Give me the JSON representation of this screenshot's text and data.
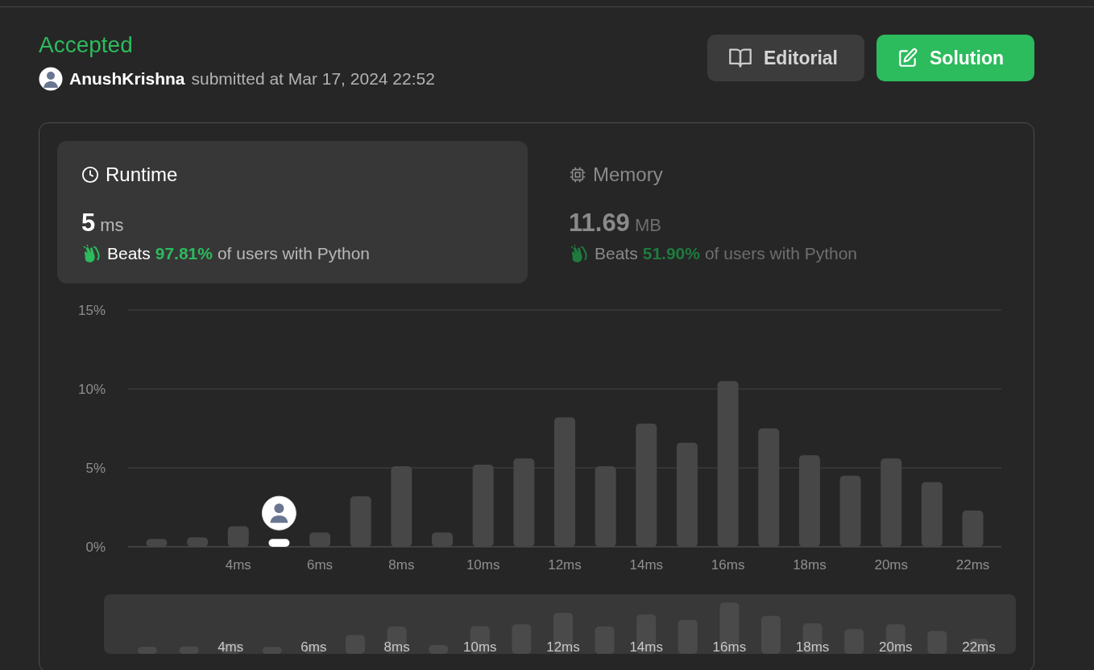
{
  "status": "Accepted",
  "submission": {
    "user": "AnushKrishna",
    "text": "submitted at Mar 17, 2024 22:52"
  },
  "buttons": [
    {
      "label": "Editorial",
      "kind": "secondary"
    },
    {
      "label": "Solution",
      "kind": "primary"
    }
  ],
  "tabs": [
    {
      "kind": "runtime",
      "label": "Runtime",
      "selected": true,
      "value": "5",
      "unit": "ms",
      "beats": "Beats",
      "percent": "97.81%",
      "suffix": "of users with Python"
    },
    {
      "kind": "memory",
      "label": "Memory",
      "selected": false,
      "value": "11.69",
      "unit": "MB",
      "beats": "Beats",
      "percent": "51.90%",
      "suffix": "of users with Python"
    }
  ],
  "chart": {
    "chart_data": {
      "type": "bar",
      "x": [
        2,
        3,
        4,
        5,
        6,
        7,
        8,
        9,
        10,
        11,
        12,
        13,
        14,
        15,
        16,
        17,
        18,
        19,
        20,
        21,
        22
      ],
      "values": [
        0.5,
        0.6,
        1.3,
        0.5,
        0.9,
        3.2,
        5.1,
        0.9,
        5.2,
        5.6,
        8.2,
        5.1,
        7.8,
        6.6,
        10.5,
        7.5,
        5.8,
        4.5,
        5.6,
        4.1,
        2.3
      ],
      "xlim": [
        1.3,
        22.7
      ],
      "ylim": [
        0,
        15
      ],
      "yticks": [
        {
          "value": 0,
          "label": "0%"
        },
        {
          "value": 5,
          "label": "5%"
        },
        {
          "value": 10,
          "label": "10%"
        },
        {
          "value": 15,
          "label": "15%"
        }
      ],
      "xticks": [
        {
          "value": 4,
          "label": "4ms"
        },
        {
          "value": 6,
          "label": "6ms"
        },
        {
          "value": 8,
          "label": "8ms"
        },
        {
          "value": 10,
          "label": "10ms"
        },
        {
          "value": 12,
          "label": "12ms"
        },
        {
          "value": 14,
          "label": "14ms"
        },
        {
          "value": 16,
          "label": "16ms"
        },
        {
          "value": 18,
          "label": "18ms"
        },
        {
          "value": 20,
          "label": "20ms"
        },
        {
          "value": 22,
          "label": "22ms"
        }
      ],
      "title": null
    },
    "bars": [
      {
        "selected": false
      },
      {
        "selected": false
      },
      {
        "selected": false
      },
      {
        "selected": true
      },
      {
        "selected": false
      },
      {
        "selected": false
      },
      {
        "selected": false
      },
      {
        "selected": false
      },
      {
        "selected": false
      },
      {
        "selected": false
      },
      {
        "selected": false
      },
      {
        "selected": false
      },
      {
        "selected": false
      },
      {
        "selected": false
      },
      {
        "selected": false
      },
      {
        "selected": false
      },
      {
        "selected": false
      },
      {
        "selected": false
      },
      {
        "selected": false
      },
      {
        "selected": false
      },
      {
        "selected": false
      }
    ]
  },
  "navigator": {
    "labels": [
      "4ms",
      "6ms",
      "8ms",
      "10ms",
      "12ms",
      "14ms",
      "16ms",
      "18ms",
      "20ms",
      "22ms"
    ]
  }
}
